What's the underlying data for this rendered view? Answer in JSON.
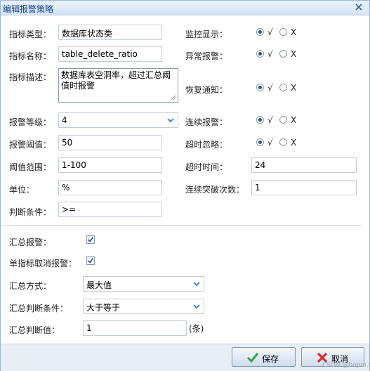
{
  "dialog": {
    "title": "编辑报警策略"
  },
  "form": {
    "metric_type": {
      "label": "指标类型：",
      "value": "数据库状态类"
    },
    "metric_name": {
      "label": "指标名称：",
      "value": "table_delete_ratio"
    },
    "metric_desc": {
      "label": "指标描述：",
      "value": "数据库表空洞率，超过汇总阈值时报警"
    },
    "alarm_level": {
      "label": "报警等级：",
      "value": "4"
    },
    "alarm_threshold": {
      "label": "报警阈值：",
      "value": "50"
    },
    "threshold_range": {
      "label": "阈值范围：",
      "value": "1-100"
    },
    "unit": {
      "label": "单位：",
      "value": "%"
    },
    "condition": {
      "label": "判断条件：",
      "value": ">="
    },
    "monitor_display": {
      "label": "监控显示：",
      "yes": "√",
      "no": "X",
      "selected": "yes"
    },
    "abnormal_alarm": {
      "label": "异常报警：",
      "yes": "√",
      "no": "X",
      "selected": "yes"
    },
    "recovery_notice": {
      "label": "恢复通知：",
      "yes": "√",
      "no": "X",
      "selected": "yes"
    },
    "continuous_alarm": {
      "label": "连续报警：",
      "yes": "√",
      "no": "X",
      "selected": "yes"
    },
    "timeout_ignore": {
      "label": "超时忽略：",
      "yes": "√",
      "no": "X",
      "selected": "yes"
    },
    "timeout_time": {
      "label": "超时时间：",
      "value": "24"
    },
    "continuous_breach": {
      "label": "连续突破次数：",
      "value": "1"
    }
  },
  "summary": {
    "summary_alarm": {
      "label": "汇总报警：",
      "checked": true
    },
    "single_cancel": {
      "label": "单指标取消报警：",
      "checked": true
    },
    "method": {
      "label": "汇总方式：",
      "value": "最大值"
    },
    "judge_condition": {
      "label": "汇总判断条件：",
      "value": "大于等于"
    },
    "judge_value": {
      "label": "汇总判断值：",
      "value": "1",
      "suffix": "(条)"
    }
  },
  "footer": {
    "save_label": "保存",
    "cancel_label": "取消"
  },
  "watermark": "CSDN @hoper.t",
  "colors": {
    "title_text": "#15428b",
    "radio_dot": "#2a4f8a",
    "chevron": "#3a7bd5",
    "save_check": "#3aa34a",
    "cancel_x": "#d32f2f"
  }
}
